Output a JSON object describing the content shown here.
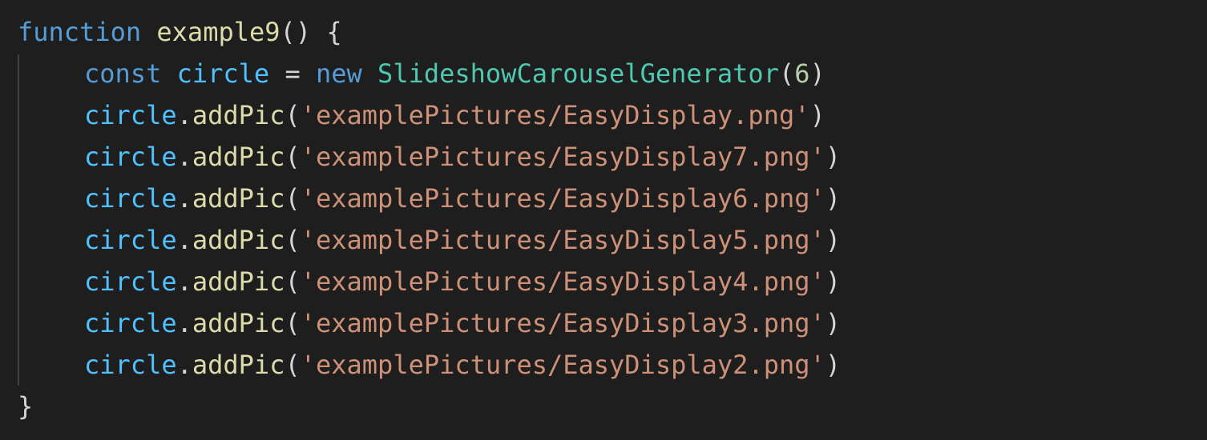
{
  "code": {
    "line1": {
      "keyword": "function",
      "name": "example9",
      "parens": "()",
      "brace": "{"
    },
    "line2": {
      "keyword": "const",
      "var": "circle",
      "op": "=",
      "new_kw": "new",
      "cls": "SlideshowCarouselGenerator",
      "open": "(",
      "arg": "6",
      "close": ")"
    },
    "calls": [
      {
        "obj": "circle",
        "dot": ".",
        "method": "addPic",
        "open": "(",
        "str": "'examplePictures/EasyDisplay.png'",
        "close": ")"
      },
      {
        "obj": "circle",
        "dot": ".",
        "method": "addPic",
        "open": "(",
        "str": "'examplePictures/EasyDisplay7.png'",
        "close": ")"
      },
      {
        "obj": "circle",
        "dot": ".",
        "method": "addPic",
        "open": "(",
        "str": "'examplePictures/EasyDisplay6.png'",
        "close": ")"
      },
      {
        "obj": "circle",
        "dot": ".",
        "method": "addPic",
        "open": "(",
        "str": "'examplePictures/EasyDisplay5.png'",
        "close": ")"
      },
      {
        "obj": "circle",
        "dot": ".",
        "method": "addPic",
        "open": "(",
        "str": "'examplePictures/EasyDisplay4.png'",
        "close": ")"
      },
      {
        "obj": "circle",
        "dot": ".",
        "method": "addPic",
        "open": "(",
        "str": "'examplePictures/EasyDisplay3.png'",
        "close": ")"
      },
      {
        "obj": "circle",
        "dot": ".",
        "method": "addPic",
        "open": "(",
        "str": "'examplePictures/EasyDisplay2.png'",
        "close": ")"
      }
    ],
    "closing_brace": "}"
  },
  "colors": {
    "background": "#1e1e1e",
    "keyword": "#569cd6",
    "variable": "#4fc1ff",
    "function": "#dcdcaa",
    "class": "#4ec9b0",
    "number": "#b5cea8",
    "string": "#ce9178",
    "punctuation": "#d4d4d4"
  }
}
